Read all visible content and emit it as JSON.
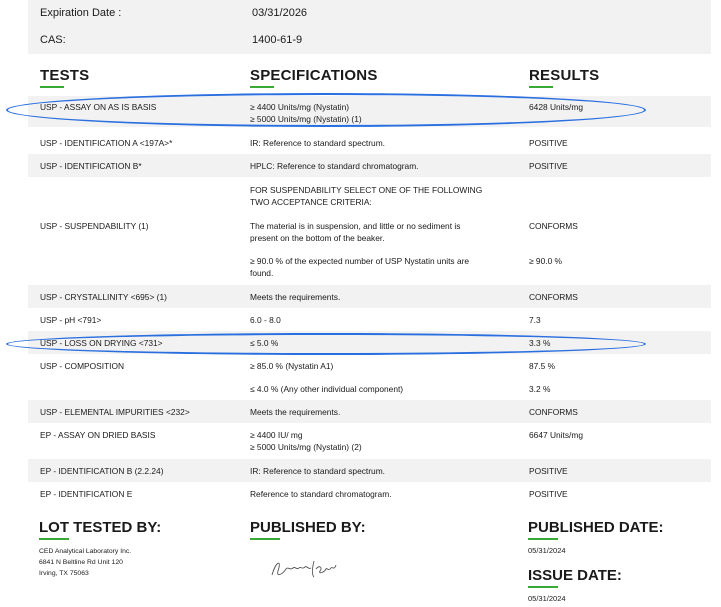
{
  "meta": [
    {
      "label": "Expiration Date :",
      "value": "03/31/2026"
    },
    {
      "label": "CAS:",
      "value": "1400-61-9"
    }
  ],
  "headers": {
    "tests": "TESTS",
    "specifications": "SPECIFICATIONS",
    "results": "RESULTS"
  },
  "rows": [
    {
      "test": "USP - ASSAY ON AS IS BASIS",
      "spec": [
        "≥ 4400 Units/mg (Nystatin)",
        "≥ 5000 Units/mg (Nystatin) (1)"
      ],
      "result": "6428 Units/mg"
    },
    {
      "test": "USP - IDENTIFICATION A <197A>*",
      "spec": [
        "IR: Reference to standard spectrum."
      ],
      "result": "POSITIVE"
    },
    {
      "test": "USP - IDENTIFICATION B*",
      "spec": [
        "HPLC: Reference to standard chromatogram."
      ],
      "result": "POSITIVE"
    },
    {
      "test": "",
      "spec": [
        "FOR SUSPENDABILITY SELECT ONE OF THE FOLLOWING",
        "TWO ACCEPTANCE CRITERIA:"
      ],
      "result": ""
    },
    {
      "test": "USP - SUSPENDABILITY  (1)",
      "spec": [
        "The material is in suspension, and little or no sediment is",
        "present on the bottom of the beaker."
      ],
      "result": "CONFORMS"
    },
    {
      "test": "",
      "spec": [
        "≥ 90.0 % of the expected number of USP Nystatin units are",
        "found."
      ],
      "result": "≥ 90.0 %"
    },
    {
      "test": "USP - CRYSTALLINITY <695> (1)",
      "spec": [
        "Meets the requirements."
      ],
      "result": "CONFORMS"
    },
    {
      "test": "USP - pH <791>",
      "spec": [
        "6.0 - 8.0"
      ],
      "result": "7.3"
    },
    {
      "test": "USP - LOSS ON DRYING <731>",
      "spec": [
        "≤ 5.0 %"
      ],
      "result": "3.3 %"
    },
    {
      "test": "USP - COMPOSITION",
      "spec": [
        "≥ 85.0 % (Nystatin A1)"
      ],
      "result": "87.5 %"
    },
    {
      "test": "",
      "spec": [
        "≤ 4.0 % (Any other individual component)"
      ],
      "result": "3.2 %"
    },
    {
      "test": "USP - ELEMENTAL IMPURITIES <232>",
      "spec": [
        "Meets the requirements."
      ],
      "result": "CONFORMS"
    },
    {
      "test": "EP - ASSAY ON DRIED BASIS",
      "spec": [
        "≥ 4400 IU/ mg",
        "≥ 5000 Units/mg (Nystatin) (2)"
      ],
      "result": "6647 Units/mg"
    },
    {
      "test": "EP - IDENTIFICATION B (2.2.24)",
      "spec": [
        "IR: Reference to standard spectrum."
      ],
      "result": "POSITIVE"
    },
    {
      "test": "EP - IDENTIFICATION E",
      "spec": [
        "Reference to standard chromatogram."
      ],
      "result": "POSITIVE"
    }
  ],
  "lot_tested_by": {
    "heading": "LOT TESTED BY:",
    "lines": [
      "CED Analytical Laboratory Inc.",
      "6841 N Beltline Rd Unit 120",
      "Irving, TX 75063"
    ]
  },
  "published_by": {
    "heading": "PUBLISHED BY:",
    "signature": "Samantha Pulley"
  },
  "published_date": {
    "heading": "PUBLISHED DATE:",
    "value": "05/31/2024"
  },
  "issue_date": {
    "heading": "ISSUE DATE:",
    "value": "05/31/2024"
  },
  "colors": {
    "accent_underline": "#3aaa35",
    "highlight_oval": "#2a6fe0",
    "row_shade": "#f2f2f2"
  }
}
